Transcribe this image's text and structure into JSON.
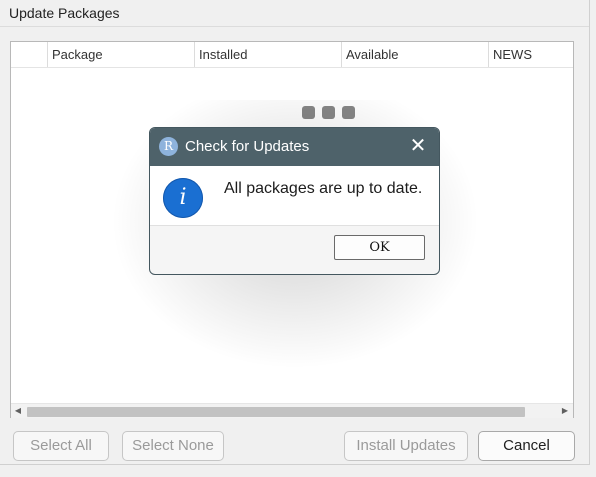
{
  "window": {
    "title": "Update Packages"
  },
  "table": {
    "columns": [
      "Package",
      "Installed",
      "Available",
      "NEWS"
    ]
  },
  "buttons": {
    "select_all": "Select All",
    "select_none": "Select None",
    "install_updates": "Install Updates",
    "cancel": "Cancel"
  },
  "dialog": {
    "title": "Check for Updates",
    "logo_letter": "R",
    "message": "All packages are up to date.",
    "ok": "OK",
    "close_glyph": "✕",
    "icon_glyph": "i",
    "icon": "info-icon"
  },
  "scroll": {
    "left": "◀",
    "right": "▶"
  },
  "colors": {
    "dialog_title_bg": "#4e626a",
    "info_icon": "#1a6fd2"
  }
}
